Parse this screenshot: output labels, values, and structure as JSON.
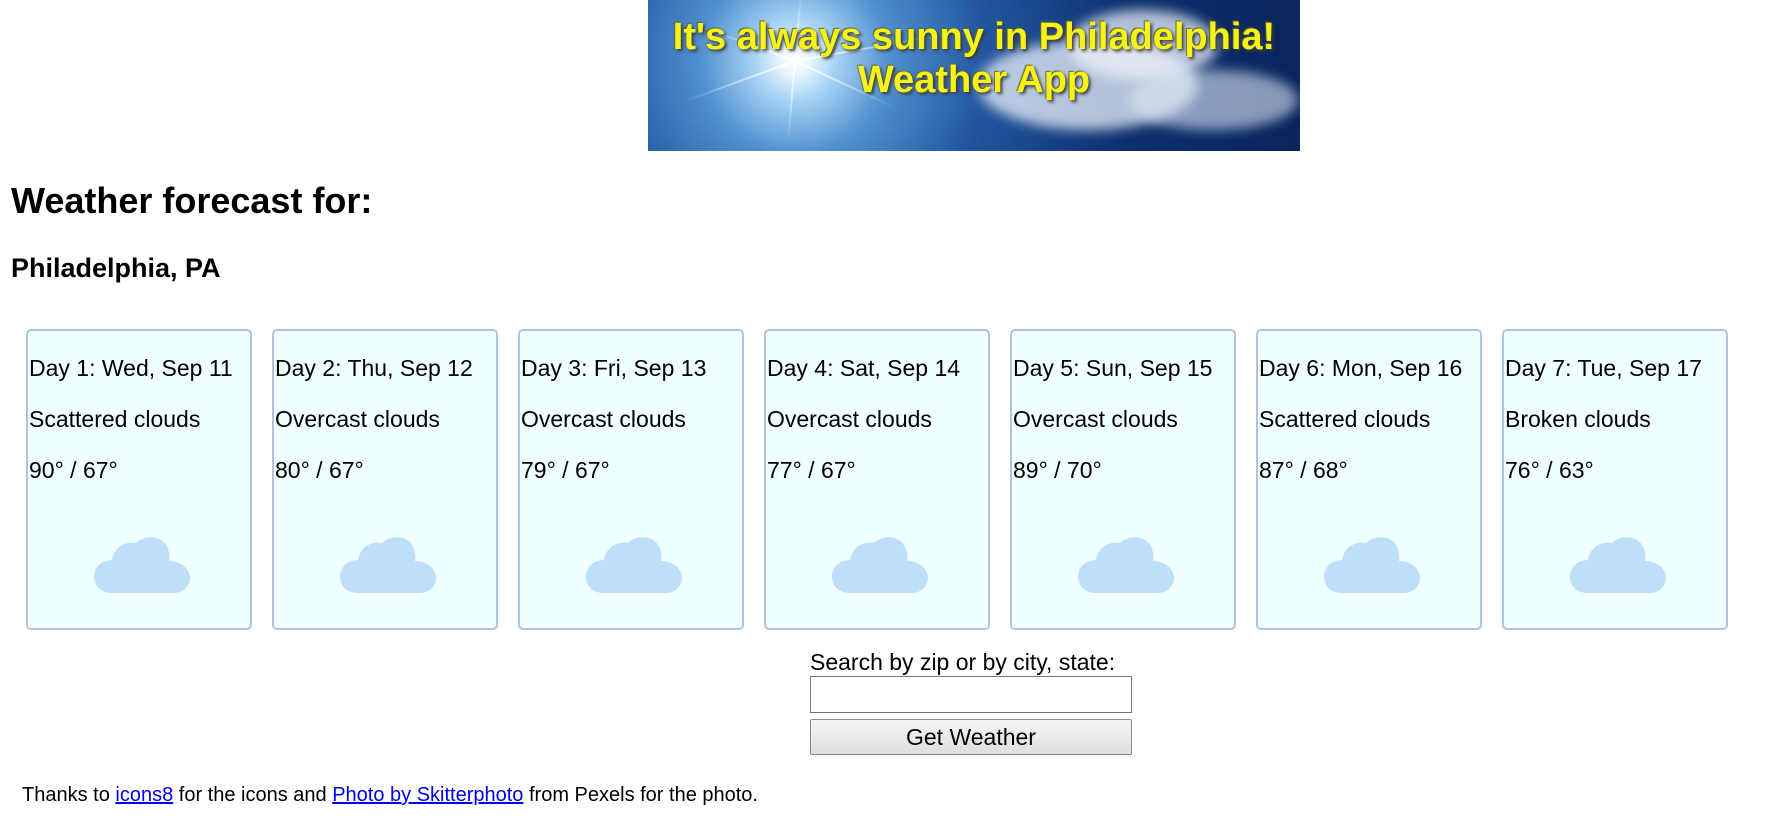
{
  "banner": {
    "line1": "It's always sunny in Philadelphia!",
    "line2": "Weather App"
  },
  "heading": {
    "title": "Weather forecast for:",
    "location": "Philadelphia, PA"
  },
  "forecast": [
    {
      "day": "Day 1: Wed, Sep 11",
      "description": "Scattered clouds",
      "temps": "90° / 67°",
      "icon": "cloud-icon"
    },
    {
      "day": "Day 2: Thu, Sep 12",
      "description": "Overcast clouds",
      "temps": "80° / 67°",
      "icon": "cloud-icon"
    },
    {
      "day": "Day 3: Fri, Sep 13",
      "description": "Overcast clouds",
      "temps": "79° / 67°",
      "icon": "cloud-icon"
    },
    {
      "day": "Day 4: Sat, Sep 14",
      "description": "Overcast clouds",
      "temps": "77° / 67°",
      "icon": "cloud-icon"
    },
    {
      "day": "Day 5: Sun, Sep 15",
      "description": "Overcast clouds",
      "temps": "89° / 70°",
      "icon": "cloud-icon"
    },
    {
      "day": "Day 6: Mon, Sep 16",
      "description": "Scattered clouds",
      "temps": "87° / 68°",
      "icon": "cloud-icon"
    },
    {
      "day": "Day 7: Tue, Sep 17",
      "description": "Broken clouds",
      "temps": "76° / 63°",
      "icon": "cloud-icon"
    }
  ],
  "search": {
    "label": "Search by zip or by city, state:",
    "value": "",
    "button_label": "Get Weather"
  },
  "credits": {
    "text_before": "Thanks to ",
    "link1": "icons8",
    "text_middle": " for the icons and ",
    "link2": "Photo by Skitterphoto",
    "text_after": " from Pexels for the photo."
  },
  "colors": {
    "card_background": "#f0ffff",
    "card_border": "#b0c4de",
    "cloud_icon": "#bddffa",
    "banner_text": "#f5f21a",
    "link": "#0000ee"
  }
}
